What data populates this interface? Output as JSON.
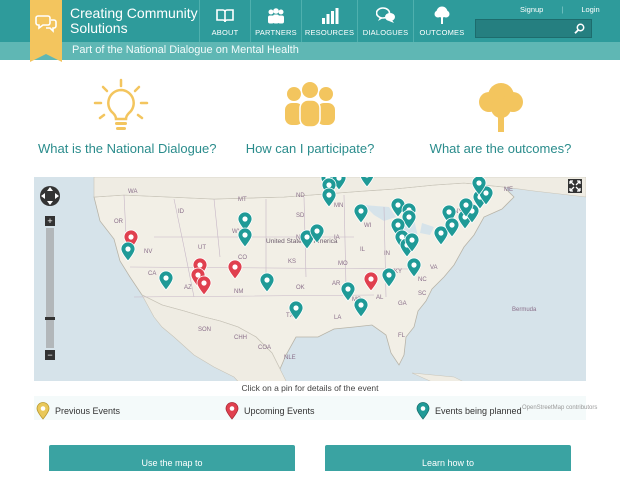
{
  "header": {
    "site_title": "Creating Community Solutions",
    "tagline": "Part of the National Dialogue on Mental Health",
    "nav": [
      {
        "label": "ABOUT",
        "icon": "book-icon"
      },
      {
        "label": "PARTNERS",
        "icon": "people-icon"
      },
      {
        "label": "RESOURCES",
        "icon": "bar-chart-icon"
      },
      {
        "label": "DIALOGUES",
        "icon": "speech-bubbles-icon"
      },
      {
        "label": "OUTCOMES",
        "icon": "tree-icon"
      }
    ],
    "signup": "Signup",
    "login": "Login",
    "search_placeholder": ""
  },
  "features": [
    {
      "label": "What is the National Dialogue?",
      "icon": "lightbulb-icon"
    },
    {
      "label": "How can I participate?",
      "icon": "group-icon"
    },
    {
      "label": "What are the outcomes?",
      "icon": "tree-icon"
    }
  ],
  "map": {
    "caption": "Click on a pin for details of the event",
    "attribution": "OpenStreetMap contributors",
    "labels": [
      "WA",
      "MT",
      "ND",
      "MN",
      "OR",
      "ID",
      "SD",
      "WI",
      "NY",
      "ME",
      "WY",
      "NE",
      "IA",
      "IL",
      "IN",
      "OH",
      "PA",
      "NV",
      "UT",
      "CO",
      "KS",
      "MO",
      "KY",
      "VA",
      "CA",
      "United States of America",
      "AZ",
      "NM",
      "OK",
      "AR",
      "TN",
      "NC",
      "SC",
      "MS",
      "AL",
      "GA",
      "TX",
      "LA",
      "FL",
      "SON",
      "CHH",
      "COA",
      "NLE",
      "Bermuda"
    ],
    "legend": {
      "previous": "Previous Events",
      "upcoming": "Upcoming Events",
      "planned": "Events being planned"
    },
    "colors": {
      "previous": "#e9c85a",
      "upcoming": "#e0404f",
      "planned": "#1f9a97"
    }
  },
  "buttons": {
    "map": "Use the map to",
    "learn": "Learn how to"
  },
  "colors": {
    "primary": "#2e9b9b",
    "accent": "#f3c55e"
  }
}
